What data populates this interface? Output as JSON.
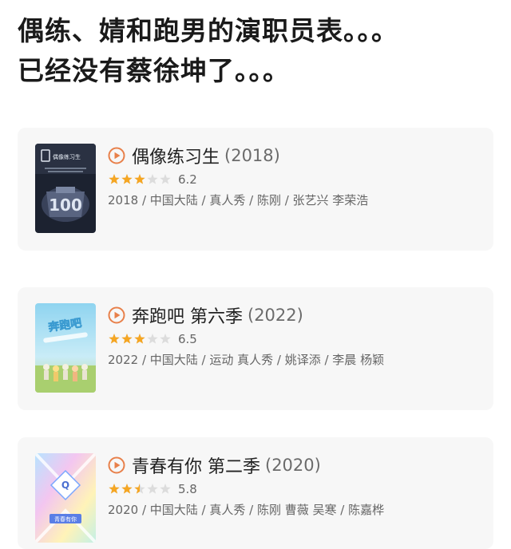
{
  "headline": {
    "line1": "偶练、婧和跑男的演职员表。。。",
    "line2": "已经没有蔡徐坤了。。。"
  },
  "accent_color": "#e8804a",
  "star_color": "#f5a623",
  "cards": [
    {
      "poster_icon": "idol-producer-poster",
      "poster_text": "偶像练习生",
      "title": "偶像练习生",
      "year": "(2018)",
      "stars_fraction": 0.6,
      "score": "6.2",
      "meta": "2018 / 中国大陆 / 真人秀 / 陈刚 / 张艺兴 李荣浩"
    },
    {
      "poster_icon": "keep-running-poster",
      "poster_text": "奔跑吧",
      "title": "奔跑吧 第六季",
      "year": "(2022)",
      "stars_fraction": 0.6,
      "score": "6.5",
      "meta": "2022 / 中国大陆 / 运动 真人秀 / 姚译添 / 李晨 杨颖"
    },
    {
      "poster_icon": "youth-with-you-poster",
      "poster_text": "青春有你",
      "title": "青春有你 第二季",
      "year": "(2020)",
      "stars_fraction": 0.5,
      "score": "5.8",
      "meta": "2020 / 中国大陆 / 真人秀 / 陈刚 曹薇 吴寒 / 陈嘉桦"
    }
  ]
}
